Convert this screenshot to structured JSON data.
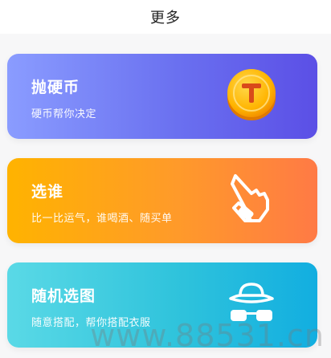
{
  "header": {
    "title": "更多"
  },
  "cards": [
    {
      "title": "抛硬币",
      "subtitle": "硬币帮你决定",
      "icon": "coin-icon",
      "colors": [
        "#8a9cff",
        "#5b4fe6"
      ]
    },
    {
      "title": "选谁",
      "subtitle": "比一比运气，谁喝酒、随买单",
      "icon": "pointing-hand-icon",
      "colors": [
        "#ffb300",
        "#ff7a45"
      ]
    },
    {
      "title": "随机选图",
      "subtitle": "随意搭配，帮你搭配衣服",
      "icon": "hat-glasses-icon",
      "colors": [
        "#5ad9e6",
        "#12aee0"
      ]
    }
  ],
  "watermark": "www.88531.cn"
}
